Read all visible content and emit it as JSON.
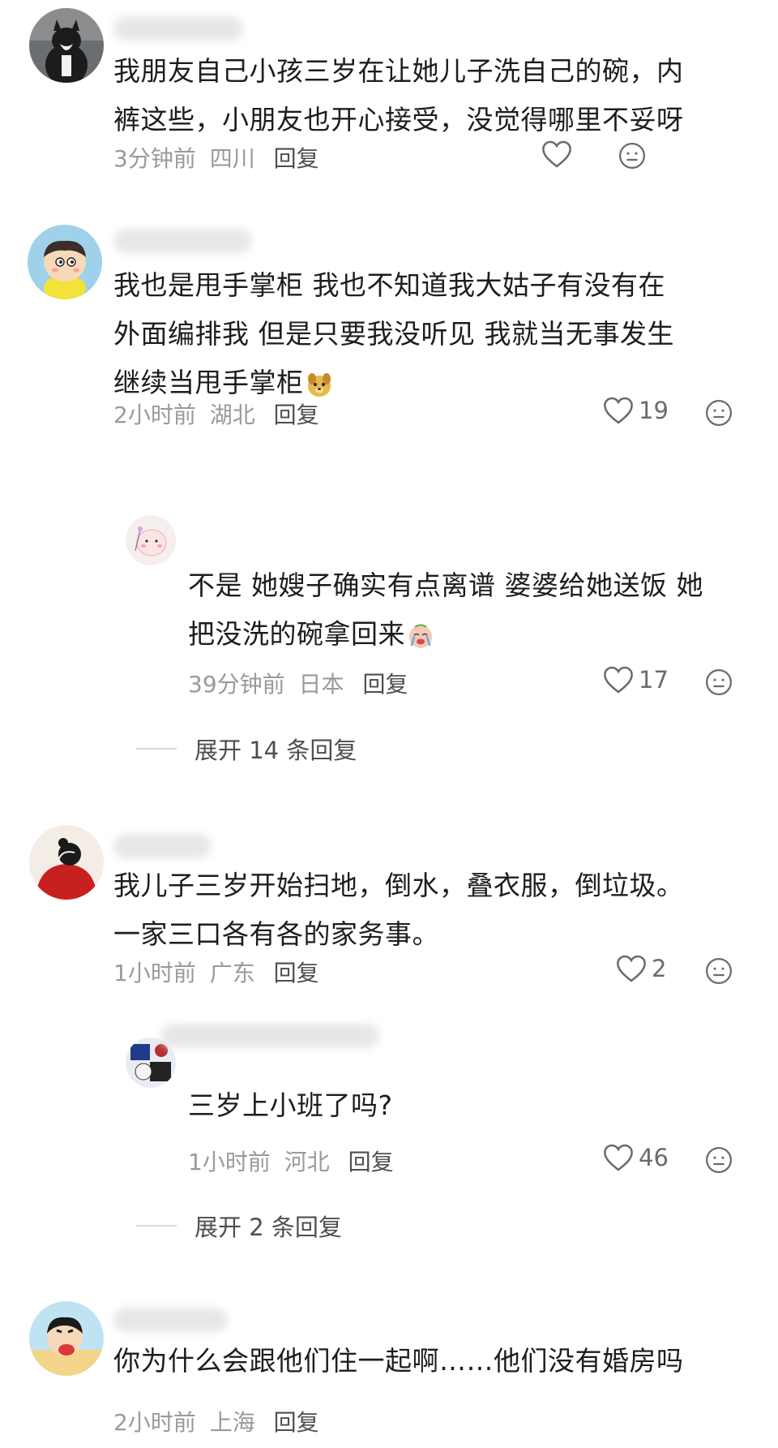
{
  "comments": [
    {
      "text_lines": [
        "我朋友自己小孩三岁在让她儿子洗自己的碗，内",
        "裤这些，小朋友也开心接受，没觉得哪里不妥呀"
      ],
      "time": "3分钟前",
      "location": "四川",
      "reply_label": "回复",
      "likes": ""
    },
    {
      "text_lines": [
        "我也是甩手掌柜  我也不知道我大姑子有没有在",
        "外面编排我  但是只要我没听见  我就当无事发生",
        "继续当甩手掌柜"
      ],
      "time": "2小时前",
      "location": "湖北",
      "reply_label": "回复",
      "likes": "19",
      "reply": {
        "text_lines": [
          "不是 她嫂子确实有点离谱 婆婆给她送饭 她",
          "把没洗的碗拿回来"
        ],
        "time": "39分钟前",
        "location": "日本",
        "reply_label": "回复",
        "likes": "17"
      },
      "expand_label": "展开 14 条回复"
    },
    {
      "text_lines": [
        "我儿子三岁开始扫地，倒水，叠衣服，倒垃圾。",
        "一家三口各有各的家务事。"
      ],
      "time": "1小时前",
      "location": "广东",
      "reply_label": "回复",
      "likes": "2",
      "reply": {
        "text_lines": [
          "三岁上小班了吗?"
        ],
        "time": "1小时前",
        "location": "河北",
        "reply_label": "回复",
        "likes": "46"
      },
      "expand_label": "展开 2 条回复"
    },
    {
      "text_lines": [
        "你为什么会跟他们住一起啊……他们没有婚房吗"
      ],
      "time": "2小时前",
      "location": "上海",
      "reply_label": "回复",
      "likes": ""
    }
  ],
  "icons": {
    "like": "heart-outline-icon",
    "dislike": "meh-face-icon"
  },
  "colors": {
    "text": "#1d1d1d",
    "meta": "#9a9a9a",
    "reply": "#4e4e4e"
  }
}
